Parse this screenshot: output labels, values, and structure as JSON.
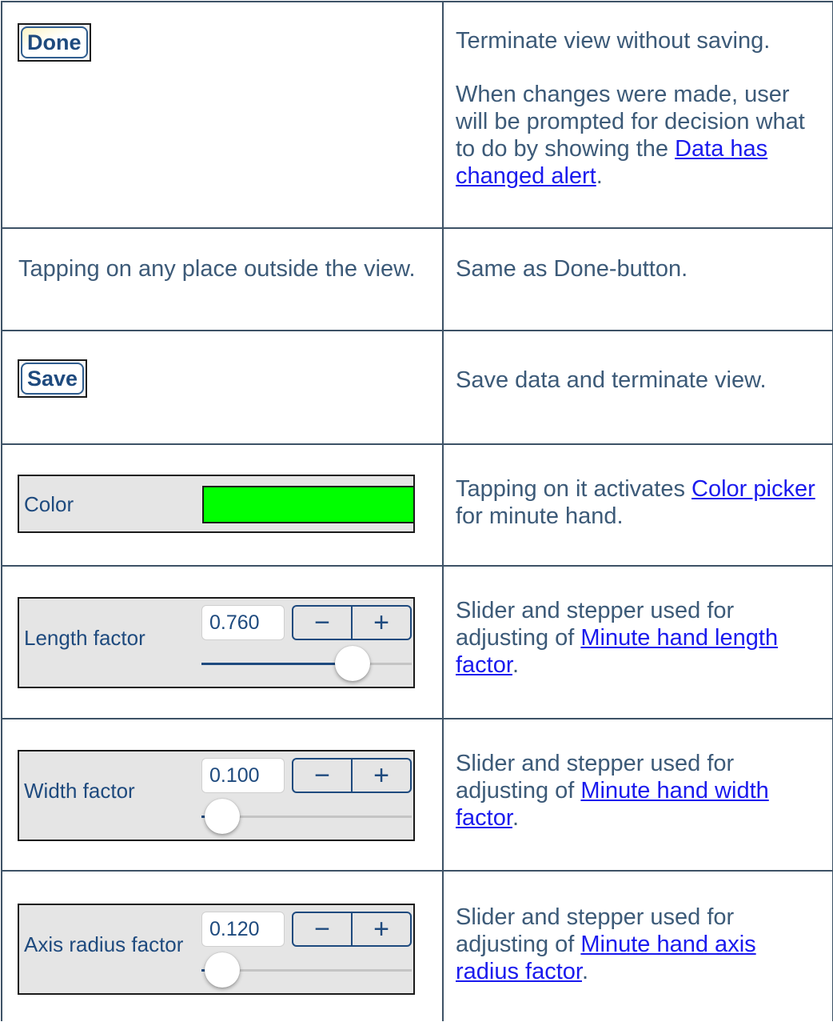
{
  "rows": [
    {
      "done_button": "Done",
      "desc_p1": "Terminate view without saving.",
      "desc_p2_before": "When changes were made, user will be prompted for decision what to do by showing the ",
      "desc_p2_link": "Data has changed alert",
      "desc_p2_after": "."
    },
    {
      "left_text": "Tapping on any place outside the view.",
      "desc": "Same as Done-button."
    },
    {
      "save_button": "Save",
      "desc": "Save data and terminate view."
    },
    {
      "panel_label": "Color",
      "swatch_color": "#00ff00",
      "desc_before": "Tapping on it activates ",
      "desc_link": "Color picker",
      "desc_after": " for minute hand."
    },
    {
      "panel_label": "Length factor",
      "value": "0.760",
      "stepper_minus": "−",
      "stepper_plus": "+",
      "slider_level": 0.72,
      "desc_before": "Slider and stepper used for adjusting of ",
      "desc_link": "Minute hand length factor",
      "desc_after": "."
    },
    {
      "panel_label": "Width factor",
      "value": "0.100",
      "stepper_minus": "−",
      "stepper_plus": "+",
      "slider_level": 0.1,
      "desc_before": "Slider and stepper used for adjusting of ",
      "desc_link": "Minute hand width factor",
      "desc_after": "."
    },
    {
      "panel_label": "Axis radius factor",
      "value": "0.120",
      "stepper_minus": "−",
      "stepper_plus": "+",
      "slider_level": 0.1,
      "desc_before": "Slider and stepper used for adjusting of ",
      "desc_link": "Minute hand axis radius factor",
      "desc_after": "."
    }
  ],
  "colors": {
    "border": "#3d5266",
    "text": "#3c5a78",
    "ios_blue": "#1e4a7e",
    "link": "#1a1aee",
    "panel_bg": "#e5e5e5"
  }
}
